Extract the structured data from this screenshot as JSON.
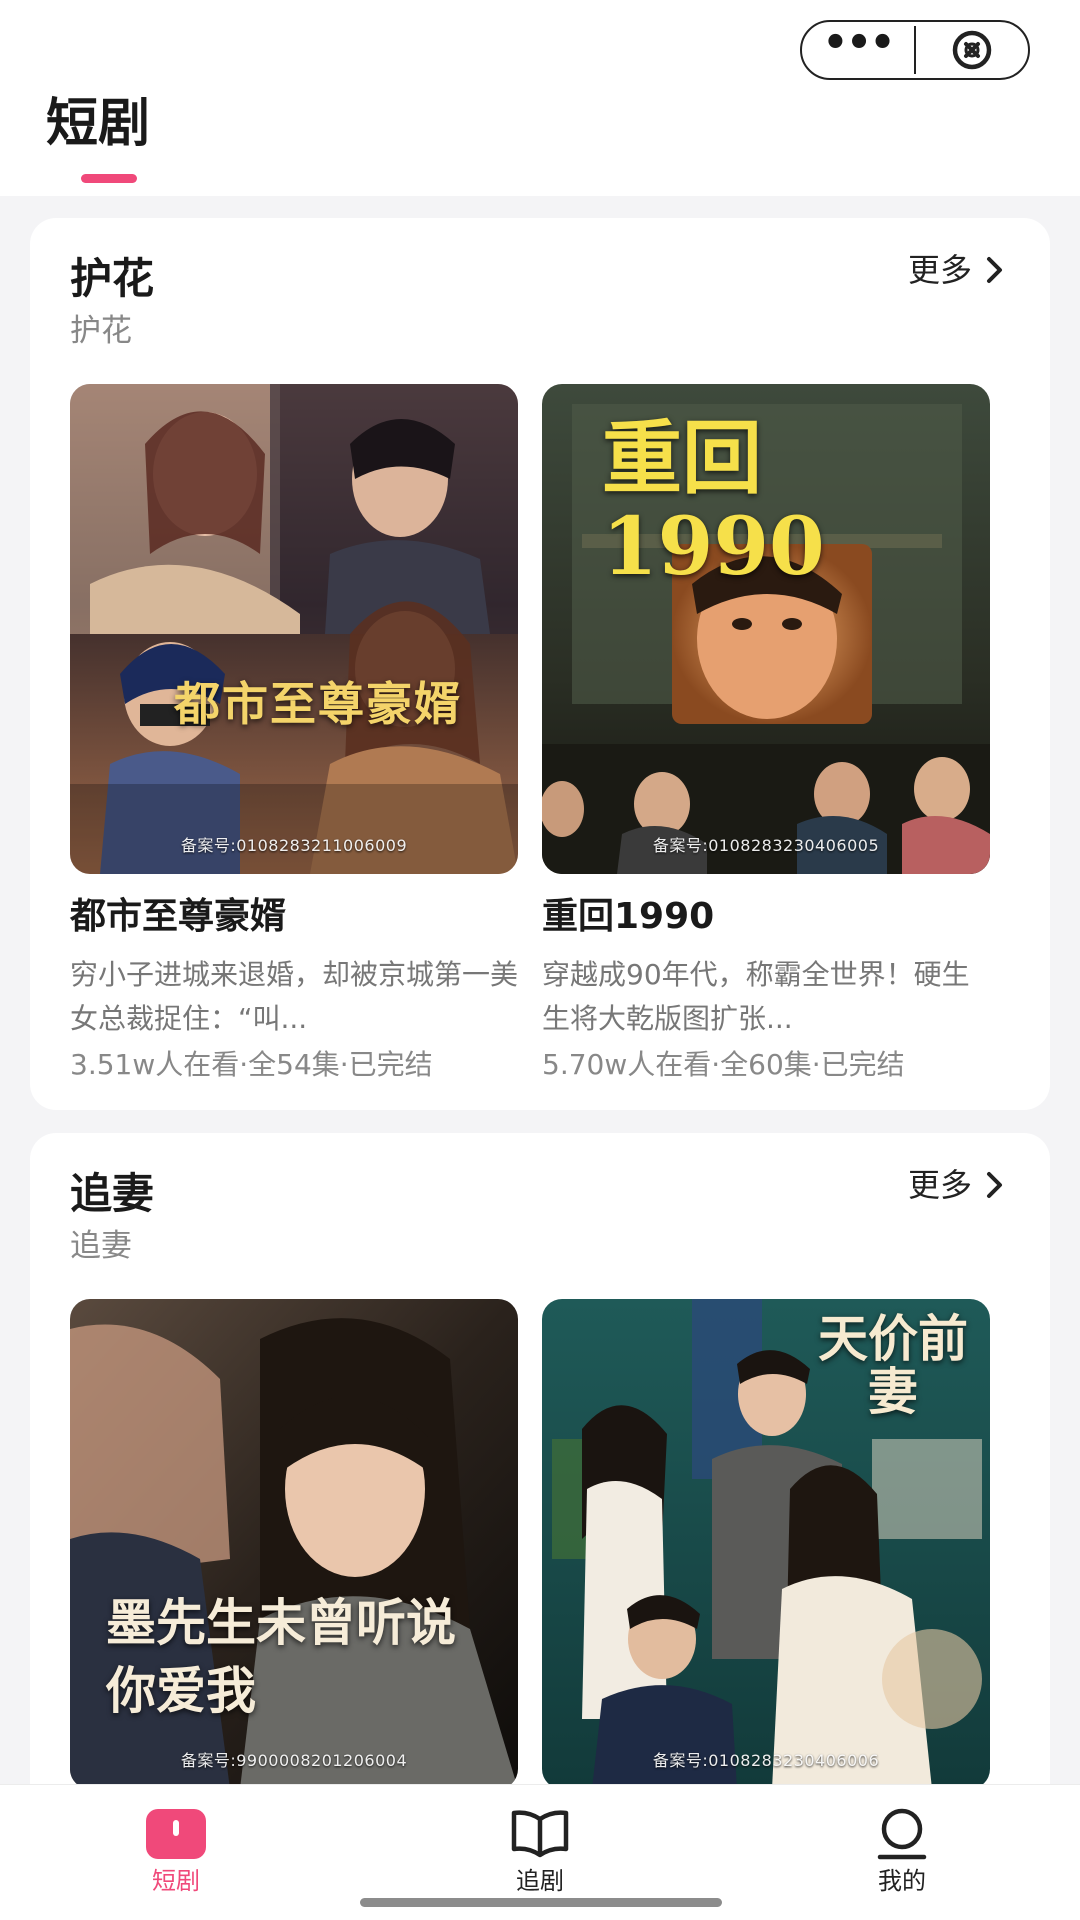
{
  "header": {
    "title": "短剧",
    "more_icon": "more-dots-icon",
    "close_icon": "close-circle-icon"
  },
  "sections": [
    {
      "title": "护花",
      "subtitle": "护花",
      "more_label": "更多",
      "dramas": [
        {
          "name": "都市至尊豪婿",
          "poster_title": "都市至尊豪婿",
          "registration": "备案号:0108283211006009",
          "description": "穷小子进城来退婚，却被京城第一美女总裁捉住：“叫...",
          "meta": "3.51w人在看·全54集·已完结"
        },
        {
          "name": "重回1990",
          "poster_title": "重回1990",
          "registration": "备案号:0108283230406005",
          "description": "穿越成90年代，称霸全世界！硬生生将大乾版图扩张...",
          "meta": "5.70w人在看·全60集·已完结"
        }
      ]
    },
    {
      "title": "追妻",
      "subtitle": "追妻",
      "more_label": "更多",
      "dramas": [
        {
          "poster_title": "墨先生未曾听说你爱我",
          "registration": "备案号:9900008201206004"
        },
        {
          "poster_title": "天价前妻",
          "registration": "备案号:0108283230406006"
        }
      ]
    }
  ],
  "tabbar": {
    "items": [
      {
        "label": "短剧",
        "icon": "shorts-icon",
        "active": true
      },
      {
        "label": "追剧",
        "icon": "book-icon",
        "active": false
      },
      {
        "label": "我的",
        "icon": "profile-icon",
        "active": false
      }
    ]
  },
  "colors": {
    "accent": "#f0497a",
    "poster_text": "#f4d46a",
    "background": "#f4f4f6"
  }
}
